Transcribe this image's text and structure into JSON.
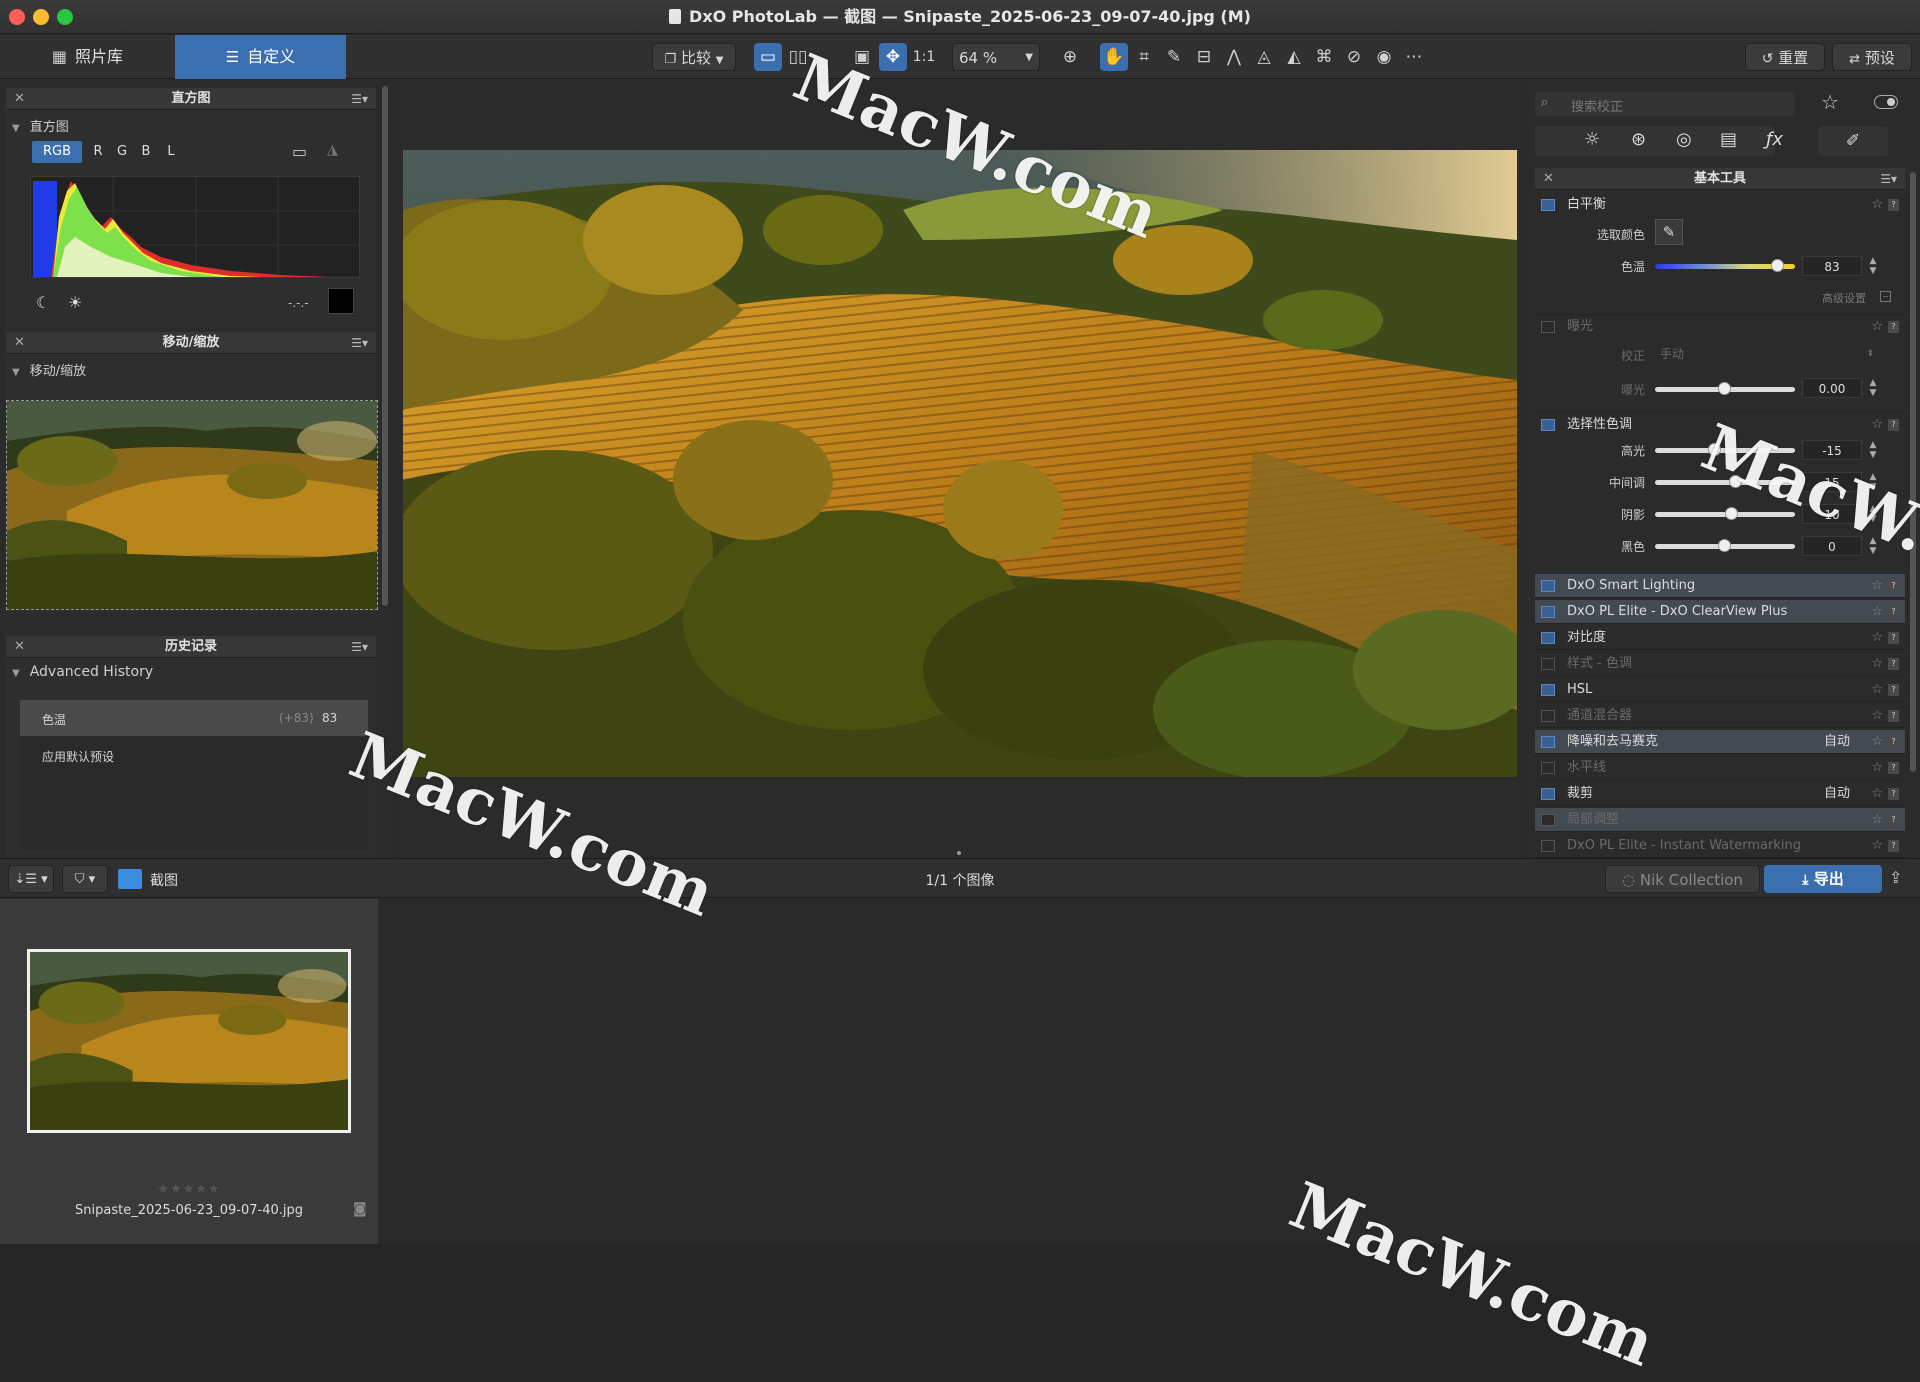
{
  "window": {
    "title": "DxO PhotoLab — 截图 — Snipaste_2025-06-23_09-07-40.jpg (M)"
  },
  "toolbar": {
    "tab_library": "照片库",
    "tab_customize": "自定义",
    "compare_label": "比较",
    "one_to_one": "1:1",
    "zoom": "64 %",
    "reset_label": "重置",
    "preset_label": "预设"
  },
  "left": {
    "histogram": {
      "panel_title": "直方图",
      "section_label": "直方图",
      "channels": [
        "RGB",
        "R",
        "G",
        "B",
        "L"
      ],
      "readout": "-.-.-"
    },
    "navigator": {
      "panel_title": "移动/缩放",
      "section_label": "移动/缩放"
    },
    "history": {
      "panel_title": "历史记录",
      "section_label": "Advanced History",
      "items": [
        {
          "name": "色温",
          "delta": "(+83)",
          "value": "83"
        },
        {
          "name": "应用默认预设",
          "delta": "",
          "value": ""
        }
      ]
    }
  },
  "right": {
    "search_placeholder": "搜索校正",
    "panel_title": "基本工具",
    "white_balance": {
      "title": "白平衡",
      "pick_color": "选取颜色",
      "temp_label": "色温",
      "temp_value": "83",
      "temp_fraction": 0.88,
      "advanced": "高级设置"
    },
    "exposure": {
      "title": "曝光",
      "correction_label": "校正",
      "correction_value": "手动",
      "exposure_label": "曝光",
      "exposure_value": "0.00",
      "exposure_fraction": 0.5
    },
    "selective_tone": {
      "title": "选择性色调",
      "sliders": [
        {
          "label": "高光",
          "value": "-15",
          "fraction": 0.43
        },
        {
          "label": "中间调",
          "value": "15",
          "fraction": 0.58
        },
        {
          "label": "阴影",
          "value": "10",
          "fraction": 0.55
        },
        {
          "label": "黑色",
          "value": "0",
          "fraction": 0.5
        }
      ]
    },
    "tools": [
      {
        "label": "DxO Smart Lighting",
        "on": true,
        "dim": false,
        "hl": true,
        "auto": ""
      },
      {
        "label": "DxO PL Elite - DxO ClearView Plus",
        "on": true,
        "dim": false,
        "hl": true,
        "auto": ""
      },
      {
        "label": "对比度",
        "on": true,
        "dim": false,
        "hl": false,
        "auto": ""
      },
      {
        "label": "样式 - 色调",
        "on": false,
        "dim": true,
        "hl": false,
        "auto": ""
      },
      {
        "label": "HSL",
        "on": true,
        "dim": false,
        "hl": false,
        "auto": ""
      },
      {
        "label": "通道混合器",
        "on": false,
        "dim": true,
        "hl": false,
        "auto": ""
      },
      {
        "label": "降噪和去马赛克",
        "on": true,
        "dim": false,
        "hl": true,
        "auto": "自动"
      },
      {
        "label": "水平线",
        "on": false,
        "dim": true,
        "hl": false,
        "auto": ""
      },
      {
        "label": "裁剪",
        "on": true,
        "dim": false,
        "hl": false,
        "auto": "自动"
      },
      {
        "label": "局部调整",
        "on": false,
        "dim": true,
        "hl": true,
        "auto": ""
      },
      {
        "label": "DxO PL Elite - Instant Watermarking",
        "on": false,
        "dim": true,
        "hl": false,
        "auto": ""
      }
    ]
  },
  "bottom": {
    "folder": "截图",
    "count": "1/1 个图像",
    "nik": "Nik Collection",
    "export": "导出",
    "thumb_name": "Snipaste_2025-06-23_09-07-40.jpg",
    "rating": "★★★★★"
  },
  "watermark": "MacW.com",
  "colors": {
    "accent": "#3b6fb0"
  }
}
